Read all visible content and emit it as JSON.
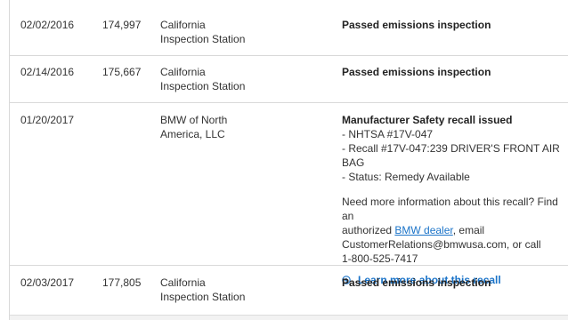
{
  "records": [
    {
      "date": "02/02/2016",
      "mileage": "174,997",
      "source_line1": "California",
      "source_line2": "Inspection Station",
      "detail_title": "Passed emissions inspection"
    },
    {
      "date": "02/14/2016",
      "mileage": "175,667",
      "source_line1": "California",
      "source_line2": "Inspection Station",
      "detail_title": "Passed emissions inspection"
    },
    {
      "date": "01/20/2017",
      "mileage": "",
      "source_line1": "BMW of North",
      "source_line2": "America, LLC",
      "detail_title": "Manufacturer Safety recall issued",
      "detail_lines": [
        "- NHTSA #17V-047",
        "- Recall #17V-047:239 DRIVER'S FRONT AIR BAG",
        "- Status: Remedy Available"
      ],
      "info_line1": "Need more information about this recall? Find an",
      "info_line2_before": "authorized ",
      "info_link": "BMW dealer",
      "info_line2_after": ", email",
      "info_line3": "CustomerRelations@bmwusa.com, or call",
      "info_line4": "1-800-525-7417",
      "learn_more": "Learn more about this recall",
      "learn_more_icon": "plus-circle-icon"
    },
    {
      "date": "02/03/2017",
      "mileage": "177,805",
      "source_line1": "California",
      "source_line2": "Inspection Station",
      "detail_title": "Passed emissions inspection"
    }
  ],
  "colors": {
    "link": "#1a73c8",
    "border": "#d9d9d9"
  }
}
